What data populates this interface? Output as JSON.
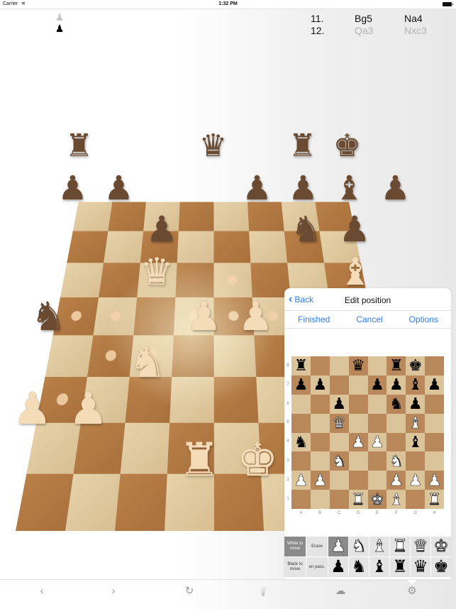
{
  "status_bar": {
    "carrier": "Carrier",
    "wifi_icon": "wifi-icon",
    "time": "1:32 PM",
    "battery_icon": "battery-icon"
  },
  "turn_indicator": {
    "white_icon": "♟",
    "black_icon": "♟",
    "side_to_move": "black"
  },
  "move_list": [
    {
      "number": "11.",
      "white": "Bg5",
      "black": "Na4",
      "state": "played"
    },
    {
      "number": "12.",
      "white": "Qa3",
      "black": "Nxc3",
      "state": "future"
    }
  ],
  "board3d": {
    "highlighted_squares": [
      "a7",
      "e7",
      "c6"
    ],
    "move_hint_dots": [
      "c6",
      "e6",
      "a5",
      "b5",
      "d5",
      "e5",
      "f5",
      "b4",
      "c4",
      "a3"
    ],
    "pieces": [
      {
        "sq": "a8",
        "glyph": "♜",
        "color": "b"
      },
      {
        "sq": "d8",
        "glyph": "♛",
        "color": "b"
      },
      {
        "sq": "f8",
        "glyph": "♜",
        "color": "b"
      },
      {
        "sq": "g8",
        "glyph": "♚",
        "color": "b"
      },
      {
        "sq": "a7",
        "glyph": "♟",
        "color": "b"
      },
      {
        "sq": "b7",
        "glyph": "♟",
        "color": "b"
      },
      {
        "sq": "e7",
        "glyph": "♟",
        "color": "b"
      },
      {
        "sq": "f7",
        "glyph": "♟",
        "color": "b"
      },
      {
        "sq": "g7",
        "glyph": "♝",
        "color": "b"
      },
      {
        "sq": "h7",
        "glyph": "♟",
        "color": "b"
      },
      {
        "sq": "c6",
        "glyph": "♟",
        "color": "b"
      },
      {
        "sq": "f6",
        "glyph": "♞",
        "color": "b"
      },
      {
        "sq": "g6",
        "glyph": "♟",
        "color": "b"
      },
      {
        "sq": "c5",
        "glyph": "♛",
        "color": "w"
      },
      {
        "sq": "g5",
        "glyph": "♝",
        "color": "w"
      },
      {
        "sq": "a4",
        "glyph": "♞",
        "color": "b"
      },
      {
        "sq": "d4",
        "glyph": "♟",
        "color": "w"
      },
      {
        "sq": "e4",
        "glyph": "♟",
        "color": "w"
      },
      {
        "sq": "c3",
        "glyph": "♞",
        "color": "w"
      },
      {
        "sq": "a2",
        "glyph": "♟",
        "color": "w"
      },
      {
        "sq": "b2",
        "glyph": "♟",
        "color": "w"
      },
      {
        "sq": "d1",
        "glyph": "♜",
        "color": "w"
      },
      {
        "sq": "e1",
        "glyph": "♚",
        "color": "w"
      }
    ]
  },
  "edit_panel": {
    "back_label": "Back",
    "title": "Edit position",
    "actions": {
      "finished": "Finished",
      "cancel": "Cancel",
      "options": "Options"
    },
    "ranks": [
      "8",
      "7",
      "6",
      "5",
      "4",
      "3",
      "2",
      "1"
    ],
    "files": [
      "A",
      "B",
      "C",
      "D",
      "E",
      "F",
      "G",
      "H"
    ],
    "position": [
      [
        "bR",
        "",
        "",
        "bQ",
        "",
        "bR",
        "bK",
        ""
      ],
      [
        "bP",
        "bP",
        "",
        "",
        "bP",
        "bP",
        "bB",
        "bP"
      ],
      [
        "",
        "",
        "bP",
        "",
        "",
        "bN",
        "bP",
        ""
      ],
      [
        "",
        "",
        "wQ",
        "",
        "",
        "",
        "wB",
        ""
      ],
      [
        "bN",
        "",
        "",
        "wP",
        "wP",
        "",
        "bB",
        ""
      ],
      [
        "",
        "",
        "wN",
        "",
        "",
        "wN",
        "",
        ""
      ],
      [
        "wP",
        "wP",
        "",
        "",
        "",
        "wP",
        "wP",
        "wP"
      ],
      [
        "",
        "",
        "",
        "wR",
        "wK",
        "wB",
        "",
        "wR"
      ]
    ],
    "palette": {
      "white_to_move": "White to move",
      "black_to_move": "Black to move",
      "erase": "Erase",
      "en_passant": "en pass.",
      "selected_side": "white",
      "selected_piece": "wP",
      "white_pieces": [
        "wP",
        "wN",
        "wB",
        "wR",
        "wQ",
        "wK"
      ],
      "black_pieces": [
        "bP",
        "bN",
        "bB",
        "bR",
        "bQ",
        "bK"
      ]
    }
  },
  "toolbar": {
    "items": [
      {
        "name": "back-icon",
        "glyph": "‹"
      },
      {
        "name": "forward-icon",
        "glyph": "›"
      },
      {
        "name": "take-back-icon",
        "glyph": "↻"
      },
      {
        "name": "hint-bulb-icon",
        "glyph": "💡"
      },
      {
        "name": "cloud-icon",
        "glyph": "☁"
      },
      {
        "name": "gear-icon",
        "glyph": "⚙"
      }
    ]
  }
}
